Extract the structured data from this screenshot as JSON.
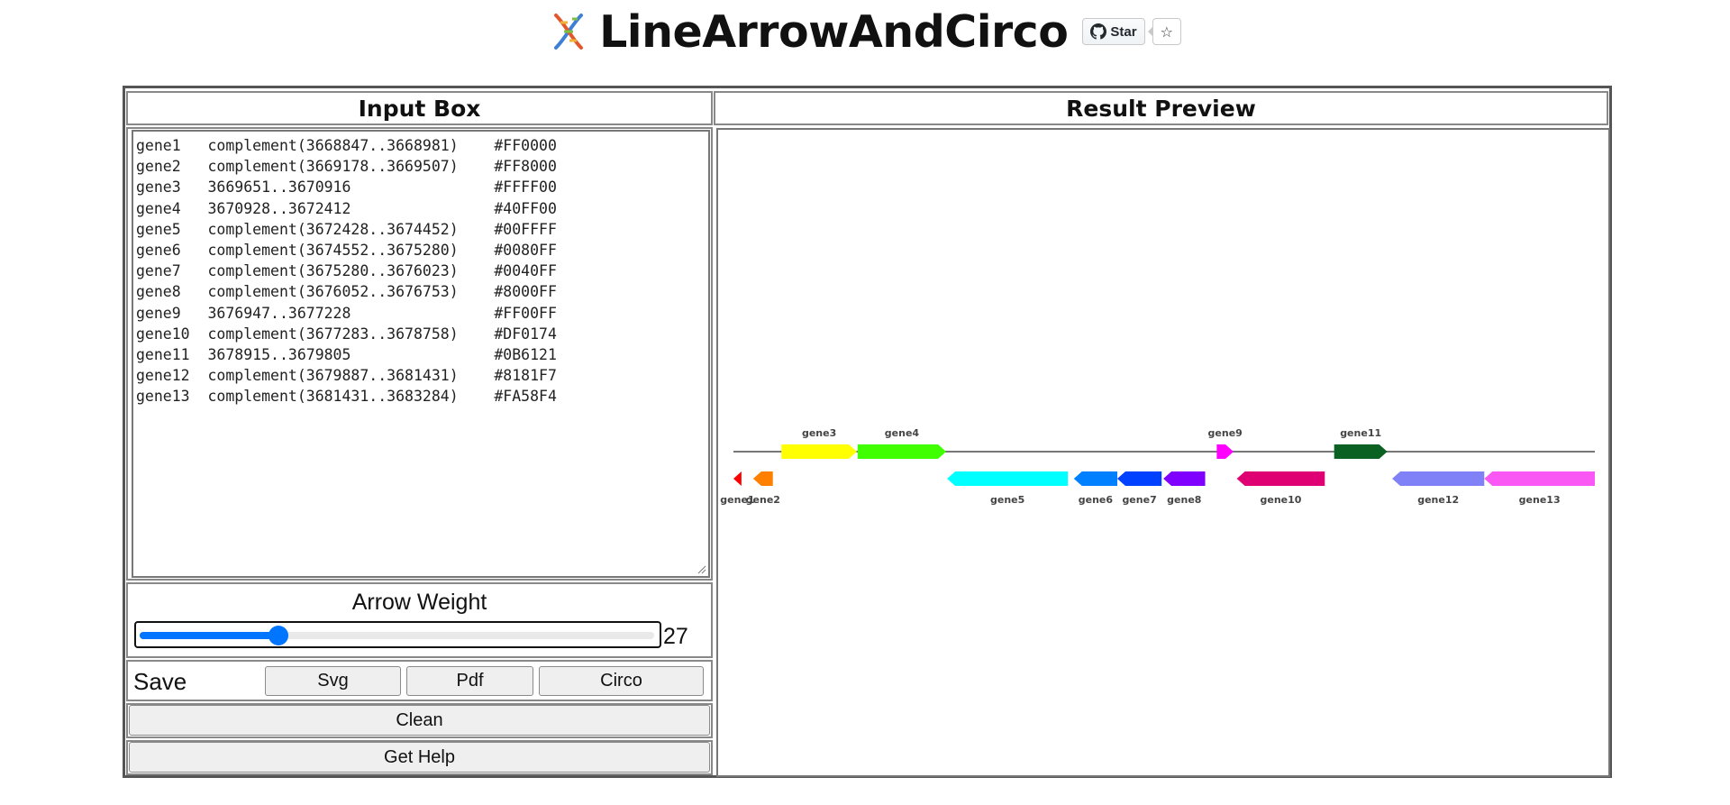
{
  "header": {
    "title": "LineArrowAndCirco",
    "star_label": "Star",
    "star_count": "☆"
  },
  "left_panel": {
    "title": "Input Box",
    "input_text": "gene1\tcomplement(3668847..3668981)\t#FF0000\ngene2\tcomplement(3669178..3669507)\t#FF8000\ngene3\t3669651..3670916\t\t#FFFF00\ngene4\t3670928..3672412\t\t#40FF00\ngene5\tcomplement(3672428..3674452)\t#00FFFF\ngene6\tcomplement(3674552..3675280)\t#0080FF\ngene7\tcomplement(3675280..3676023)\t#0040FF\ngene8\tcomplement(3676052..3676753)\t#8000FF\ngene9\t3676947..3677228\t\t#FF00FF\ngene10\tcomplement(3677283..3678758)\t#DF0174\ngene11\t3678915..3679805\t\t#0B6121\ngene12\tcomplement(3679887..3681431)\t#8181F7\ngene13\tcomplement(3681431..3683284)\t#FA58F4",
    "arrow_weight_label": "Arrow Weight",
    "arrow_weight_value": "27",
    "arrow_weight_fraction": 0.27,
    "save_label": "Save",
    "svg_button": "Svg",
    "pdf_button": "Pdf",
    "circo_button": "Circo",
    "clean_button": "Clean",
    "help_button": "Get Help"
  },
  "right_panel": {
    "title": "Result Preview"
  },
  "preview": {
    "line_color": "#777777",
    "start": 3668847,
    "end": 3683284,
    "genes": [
      {
        "name": "gene1",
        "start": 3668847,
        "end": 3668981,
        "strand": "-",
        "color": "#FF0000",
        "label": "gene1"
      },
      {
        "name": "gene2",
        "start": 3669178,
        "end": 3669507,
        "strand": "-",
        "color": "#FF8000",
        "label": "gene2"
      },
      {
        "name": "gene3",
        "start": 3669651,
        "end": 3670916,
        "strand": "+",
        "color": "#FFFF00",
        "label": "gene3"
      },
      {
        "name": "gene4",
        "start": 3670928,
        "end": 3672412,
        "strand": "+",
        "color": "#40FF00",
        "label": "gene4"
      },
      {
        "name": "gene5",
        "start": 3672428,
        "end": 3674452,
        "strand": "-",
        "color": "#00FFFF",
        "label": "gene5"
      },
      {
        "name": "gene6",
        "start": 3674552,
        "end": 3675280,
        "strand": "-",
        "color": "#0080FF",
        "label": "gene6"
      },
      {
        "name": "gene7",
        "start": 3675280,
        "end": 3676023,
        "strand": "-",
        "color": "#0040FF",
        "label": "gene7"
      },
      {
        "name": "gene8",
        "start": 3676052,
        "end": 3676753,
        "strand": "-",
        "color": "#8000FF",
        "label": "gene8"
      },
      {
        "name": "gene9",
        "start": 3676947,
        "end": 3677228,
        "strand": "+",
        "color": "#FF00FF",
        "label": "gene9"
      },
      {
        "name": "gene10",
        "start": 3677283,
        "end": 3678758,
        "strand": "-",
        "color": "#DF0174",
        "label": "gene10"
      },
      {
        "name": "gene11",
        "start": 3678915,
        "end": 3679805,
        "strand": "+",
        "color": "#0B6121",
        "label": "gene11"
      },
      {
        "name": "gene12",
        "start": 3679887,
        "end": 3681431,
        "strand": "-",
        "color": "#8181F7",
        "label": "gene12"
      },
      {
        "name": "gene13",
        "start": 3681431,
        "end": 3683284,
        "strand": "-",
        "color": "#FA58F4",
        "label": "gene13"
      }
    ]
  }
}
